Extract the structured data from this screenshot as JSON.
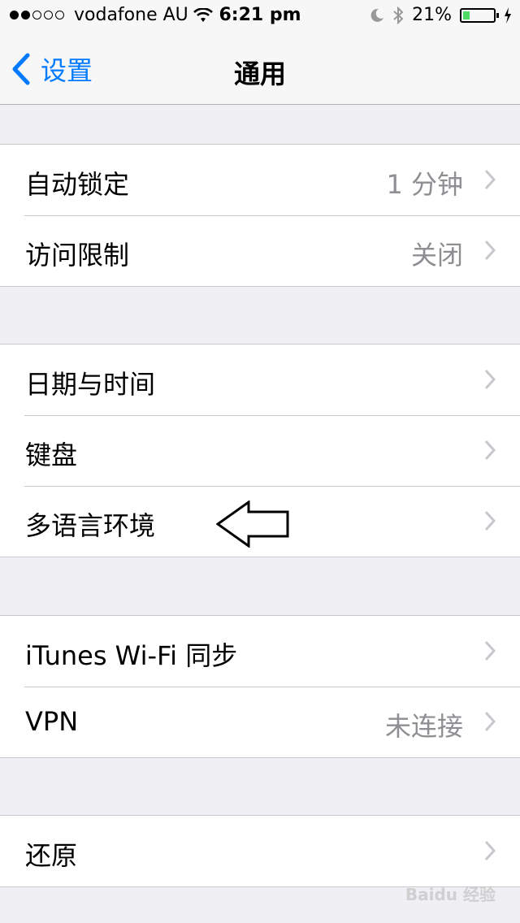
{
  "status_bar": {
    "carrier": "vodafone AU",
    "time": "6:21 pm",
    "battery_percent": "21%",
    "battery_level": 0.21,
    "icons": [
      "signal-dots-icon",
      "wifi-icon",
      "moon-icon",
      "bluetooth-icon",
      "battery-icon",
      "charging-bolt-icon"
    ]
  },
  "nav": {
    "back_label": "设置",
    "title": "通用"
  },
  "groups": [
    {
      "rows": [
        {
          "label": "自动锁定",
          "value": "1 分钟"
        },
        {
          "label": "访问限制",
          "value": "关闭"
        }
      ]
    },
    {
      "rows": [
        {
          "label": "日期与时间",
          "value": ""
        },
        {
          "label": "键盘",
          "value": ""
        },
        {
          "label": "多语言环境",
          "value": ""
        }
      ]
    },
    {
      "rows": [
        {
          "label": "iTunes Wi-Fi 同步",
          "value": ""
        },
        {
          "label": "VPN",
          "value": "未连接"
        }
      ]
    },
    {
      "rows": [
        {
          "label": "还原",
          "value": ""
        }
      ]
    }
  ],
  "colors": {
    "accent": "#007aff",
    "background": "#efeff4",
    "secondary_text": "#8e8e93",
    "battery": "#4cd964"
  },
  "watermark": "Baidu 经验"
}
